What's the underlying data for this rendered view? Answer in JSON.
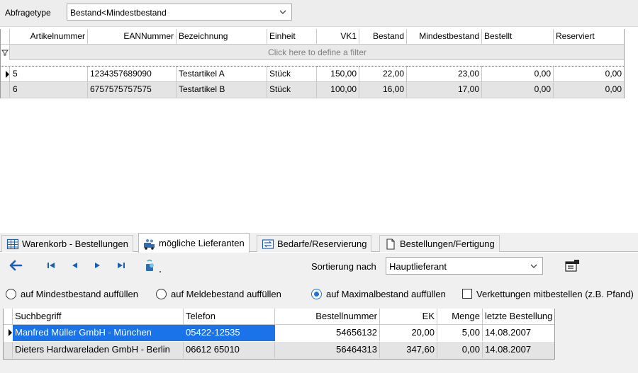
{
  "query": {
    "label": "Abfragetype",
    "selected": "Bestand<Mindestbestand"
  },
  "grid1": {
    "columns": [
      "Artikelnummer",
      "EANNummer",
      "Bezeichnung",
      "Einheit",
      "VK1",
      "Bestand",
      "Mindestbestand",
      "Bestellt",
      "Reserviert"
    ],
    "filter_hint": "Click here to define a filter",
    "rows": [
      {
        "Artikelnummer": "5",
        "EANNummer": "1234357689090",
        "Bezeichnung": "Testartikel A",
        "Einheit": "Stück",
        "VK1": "150,00",
        "Bestand": "22,00",
        "Mindestbestand": "23,00",
        "Bestellt": "0,00",
        "Reserviert": "0,00"
      },
      {
        "Artikelnummer": "6",
        "EANNummer": "6757575757575",
        "Bezeichnung": "Testartikel B",
        "Einheit": "Stück",
        "VK1": "100,00",
        "Bestand": "16,00",
        "Mindestbestand": "17,00",
        "Bestellt": "0,00",
        "Reserviert": "0,00"
      }
    ]
  },
  "tabs": [
    {
      "label": "Warenkorb - Bestellungen",
      "icon": "grid-icon",
      "active": false
    },
    {
      "label": "mögliche Lieferanten",
      "icon": "suppliers-icon",
      "active": true
    },
    {
      "label": "Bedarfe/Reservierung",
      "icon": "transfer-icon",
      "active": false
    },
    {
      "label": "Bestellungen/Fertigung",
      "icon": "document-icon",
      "active": false
    }
  ],
  "sort": {
    "label": "Sortierung nach",
    "selected": "Hauptlieferant"
  },
  "options": {
    "radio_min": "auf Mindestbestand auffüllen",
    "radio_melde": "auf Meldebestand auffüllen",
    "radio_max": "auf Maximalbestand auffüllen",
    "selected": "radio_max",
    "checkbox_label": "Verkettungen mitbestellen (z.B. Pfand)",
    "checkbox_checked": false
  },
  "grid2": {
    "columns": [
      "Suchbegriff",
      "Telefon",
      "Bestellnummer",
      "EK",
      "Menge",
      "letzte Bestellung"
    ],
    "rows": [
      {
        "Suchbegriff": "Manfred Müller GmbH - München",
        "Telefon": "05422-12535",
        "Bestellnummer": "54656132",
        "EK": "20,00",
        "Menge": "5,00",
        "letzte Bestellung": "14.08.2007"
      },
      {
        "Suchbegriff": "Dieters Hardwareladen GmbH - Berlin",
        "Telefon": "06612 65010",
        "Bestellnummer": "56464313",
        "EK": "347,60",
        "Menge": "0,00",
        "letzte Bestellung": "14.08.2007"
      }
    ]
  },
  "colors": {
    "selection": "#1a73e8",
    "nav_arrow": "#1a5fb4",
    "alt_row": "#e4e4e4"
  }
}
